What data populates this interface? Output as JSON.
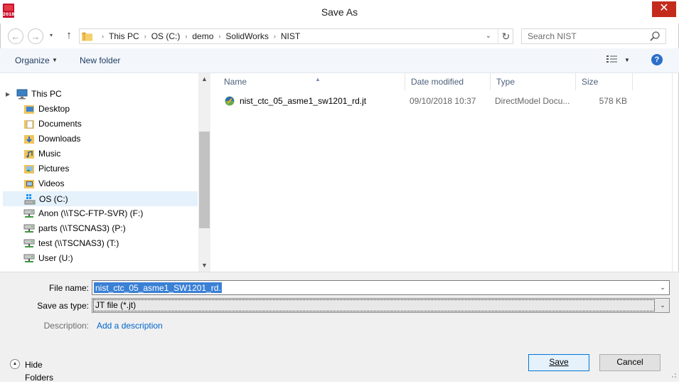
{
  "window": {
    "title": "Save As",
    "app_icon": "solidworks-2018-icon",
    "app_icon_text": "2018",
    "close_glyph": "✕"
  },
  "nav": {
    "back_glyph": "←",
    "forward_glyph": "→",
    "recent_glyph": "▾",
    "up_glyph": "↑",
    "breadcrumbs": [
      "This PC",
      "OS (C:)",
      "demo",
      "SolidWorks",
      "NIST"
    ],
    "crumb_separator": "›",
    "address_dropdown_glyph": "⌄",
    "refresh_glyph": "↻",
    "search_placeholder": "Search NIST"
  },
  "toolbar": {
    "organize_label": "Organize",
    "organize_caret": "▼",
    "new_folder_label": "New folder",
    "view_caret": "▼",
    "help_glyph": "?"
  },
  "sidebar": {
    "expand_glyph": "▶",
    "items": [
      {
        "label": "This PC",
        "icon": "computer-icon"
      },
      {
        "label": "Desktop",
        "icon": "desktop-folder-icon"
      },
      {
        "label": "Documents",
        "icon": "documents-folder-icon"
      },
      {
        "label": "Downloads",
        "icon": "downloads-folder-icon"
      },
      {
        "label": "Music",
        "icon": "music-folder-icon"
      },
      {
        "label": "Pictures",
        "icon": "pictures-folder-icon"
      },
      {
        "label": "Videos",
        "icon": "videos-folder-icon"
      },
      {
        "label": "OS (C:)",
        "icon": "windows-drive-icon",
        "selected": true
      },
      {
        "label": "Anon (\\\\TSC-FTP-SVR) (F:)",
        "icon": "network-drive-icon"
      },
      {
        "label": "parts (\\\\TSCNAS3) (P:)",
        "icon": "network-drive-icon"
      },
      {
        "label": "test (\\\\TSCNAS3) (T:)",
        "icon": "network-drive-icon"
      },
      {
        "label": "User (U:)",
        "icon": "network-drive-icon"
      }
    ],
    "scroll_up_glyph": "▲",
    "scroll_down_glyph": "▼"
  },
  "file_list": {
    "sort_glyph": "▲",
    "columns": [
      "Name",
      "Date modified",
      "Type",
      "Size"
    ],
    "rows": [
      {
        "name": "nist_ctc_05_asme1_sw1201_rd.jt",
        "date": "09/10/2018 10:37",
        "type": "DirectModel Docu...",
        "size": "578 KB",
        "icon": "jt-file-icon"
      }
    ]
  },
  "form": {
    "filename_label": "File name:",
    "filename_value": "nist_ctc_05_asme1_SW1201_rd.JT",
    "savetype_label": "Save as type:",
    "savetype_value": "JT file (*.jt)",
    "dropdown_glyph": "⌄",
    "description_label": "Description:",
    "add_description_link": "Add a description",
    "hide_folders_label": "Hide Folders",
    "hide_folders_glyph": "▲",
    "save_label": "Save",
    "cancel_label": "Cancel"
  },
  "colors": {
    "accent": "#0078d7",
    "selection": "#3a80d5",
    "close": "#c42b1c",
    "link": "#0066cc"
  }
}
